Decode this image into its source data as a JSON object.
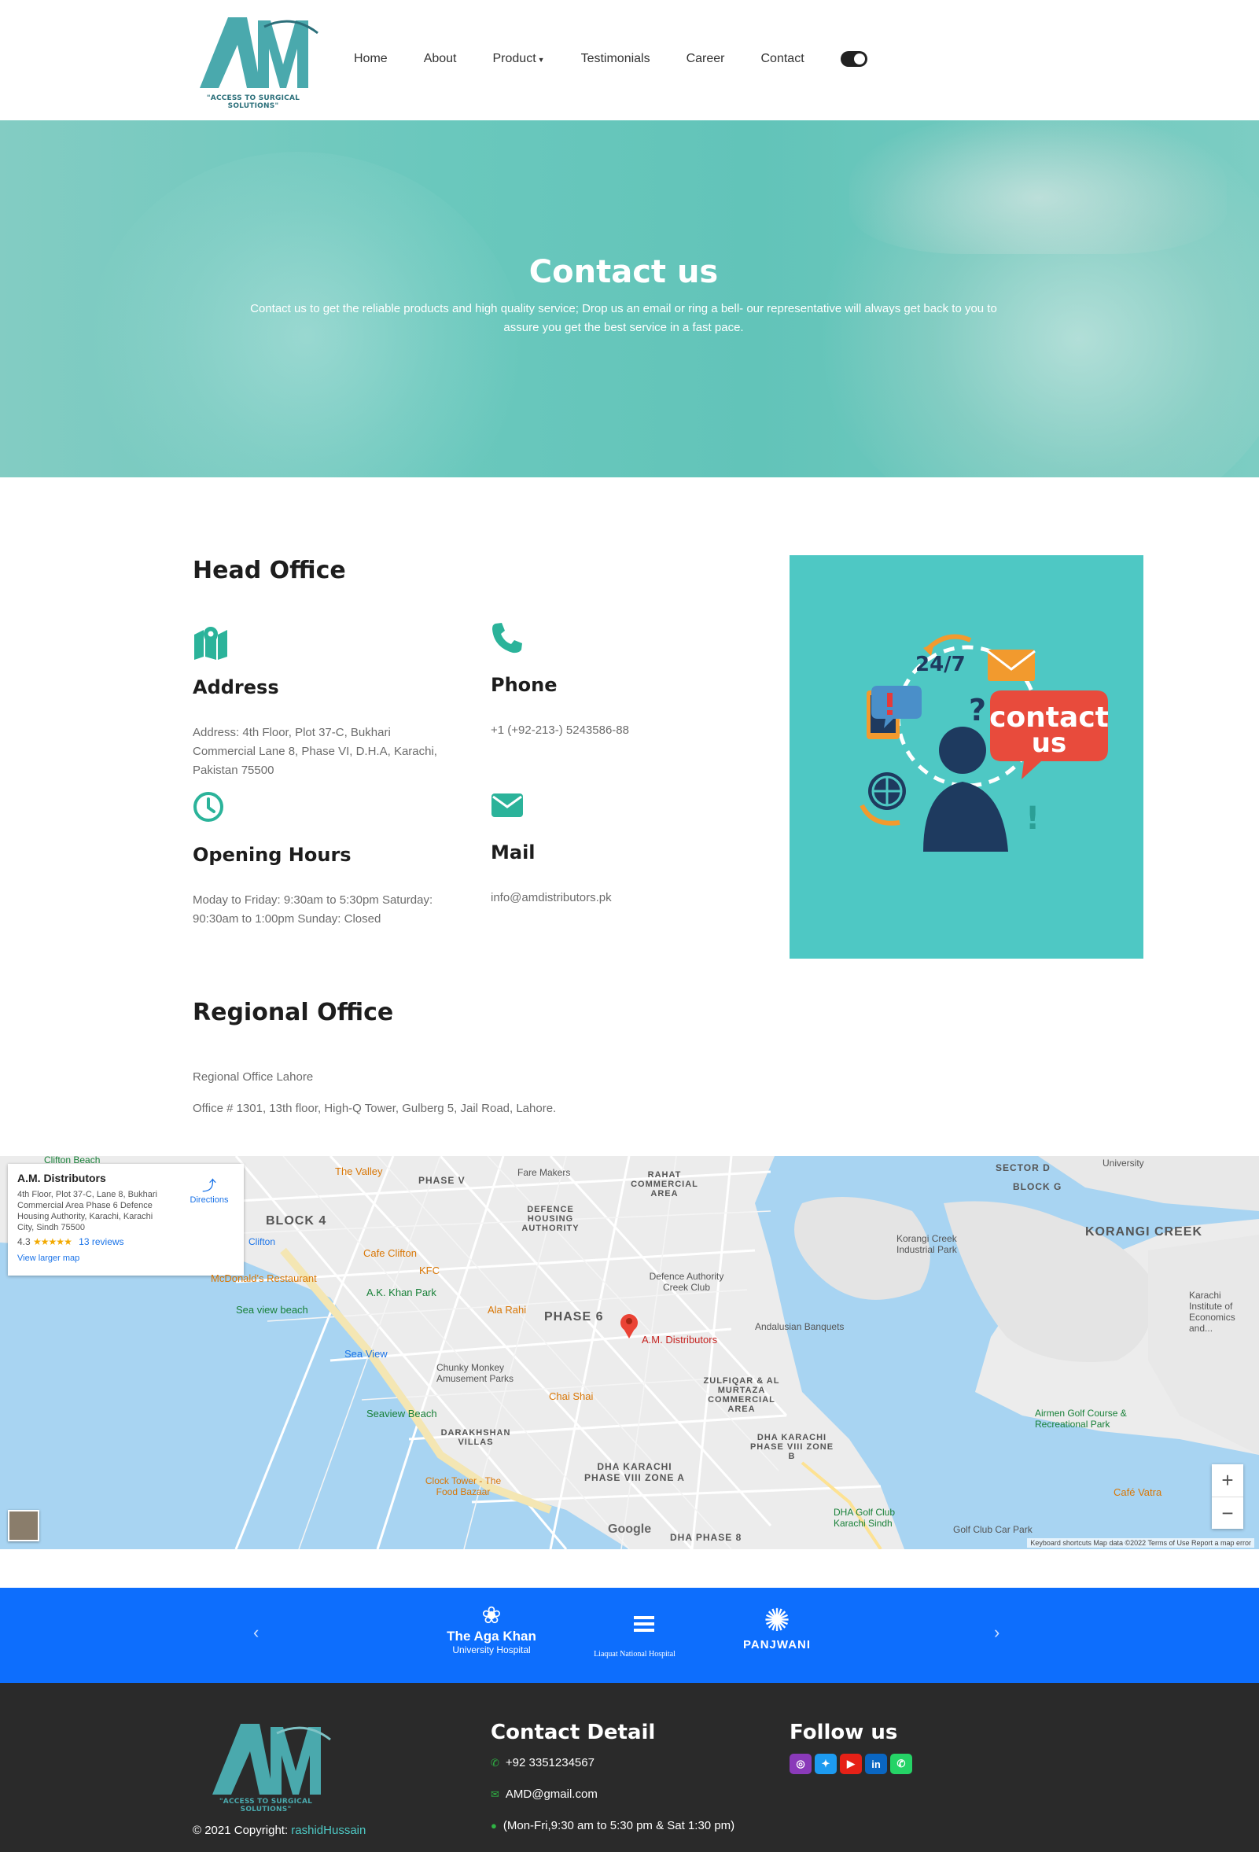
{
  "brand": {
    "tagline": "\"ACCESS TO SURGICAL SOLUTIONS\"",
    "logo_color": "#4aa9ad"
  },
  "nav": {
    "items": [
      {
        "label": "Home"
      },
      {
        "label": "About"
      },
      {
        "label": "Product"
      },
      {
        "label": "Testimonials"
      },
      {
        "label": "Career"
      },
      {
        "label": "Contact"
      }
    ],
    "theme_toggle": "on"
  },
  "hero": {
    "title": "Contact us",
    "subtitle": "Contact us to get the reliable products and high quality service; Drop us an email or ring a bell- our representative will always get back to you to assure you get the best service in a fast pace."
  },
  "head_office": {
    "title": "Head Office",
    "address": {
      "title": "Address",
      "icon": "map-marker-icon",
      "text": "Address: 4th Floor, Plot 37-C, Bukhari Commercial Lane 8, Phase VI, D.H.A, Karachi, Pakistan 75500"
    },
    "phone": {
      "title": "Phone",
      "icon": "phone-icon",
      "text": "+1 (+92-213-) 5243586-88"
    },
    "hours": {
      "title": "Opening Hours",
      "icon": "clock-icon",
      "text": "Moday to Friday: 9:30am to 5:30pm Saturday: 90:30am to 1:00pm Sunday: Closed"
    },
    "mail": {
      "title": "Mail",
      "icon": "envelope-icon",
      "text": "info@amdistributors.pk"
    },
    "image": {
      "badge": "24/7",
      "line1": "contact",
      "line2": "us",
      "bg": "#4ec8c4"
    }
  },
  "regional_office": {
    "title": "Regional Office",
    "name": "Regional Office Lahore",
    "address": "Office # 1301, 13th floor, High-Q Tower, Gulberg 5, Jail Road, Lahore."
  },
  "map": {
    "card": {
      "title": "A.M. Distributors",
      "address": "4th Floor, Plot 37-C, Lane 8, Bukhari Commercial Area Phase 6 Defence Housing Authority, Karachi, Karachi City, Sindh 75500",
      "rating": "4.3",
      "stars": "★★★★★",
      "reviews": "13 reviews",
      "larger": "View larger map",
      "directions": "Directions"
    },
    "pin_label": "A.M. Distributors",
    "labels": {
      "phase6": "PHASE 6",
      "block4": "BLOCK 4",
      "korangi": "KORANGI CREEK",
      "dha8": "DHA KARACHI PHASE VIII ZONE A",
      "defence": "DEFENCE HOUSING AUTHORITY",
      "phasev": "PHASE V",
      "rahat": "RAHAT COMMERCIAL AREA",
      "zulfiqar": "ZULFIQAR & AL MURTAZA COMMERCIAL AREA",
      "darakhshan": "DARAKHSHAN VILLAS",
      "dha8b": "DHA KARACHI PHASE VIII ZONE B",
      "sector": "SECTOR D",
      "blockg": "BLOCK G",
      "dhaphase8": "DHA PHASE 8"
    },
    "pois": [
      "The Valley",
      "Cafe Clifton",
      "KFC",
      "McDonald's Restaurant",
      "A.K. Khan Park",
      "Sea view beach",
      "Ala Rahi",
      "Sea View",
      "Chunky Monkey Amusement Parks",
      "Chai Shai",
      "Seaview Beach",
      "Clock Tower - The Food Bazaar",
      "Defence Authority Creek Club",
      "Andalusian Banquets",
      "Korangi Creek Industrial Park",
      "Airmen Golf Course & Recreational Park",
      "Café Vatra",
      "DHA Golf Club Karachi Sindh",
      "Golf Club Car Park",
      "Fare Makers",
      "Clifton Beach",
      "Clifton",
      "University",
      "Karachi Institute of Economics and..."
    ],
    "zoom_in": "+",
    "zoom_out": "−",
    "google": "Google",
    "footer": "Keyboard shortcuts   Map data ©2022   Terms of Use   Report a map error"
  },
  "partners": {
    "prev": "‹",
    "next": "›",
    "items": [
      {
        "name": "The Aga Khan",
        "sub": "University Hospital"
      },
      {
        "name": "Liaquat National Hospital",
        "sub": ""
      },
      {
        "name": "PANJWANI",
        "sub": ""
      }
    ]
  },
  "footer": {
    "contact_title": "Contact Detail",
    "phone": "+92 3351234567",
    "email": "AMD@gmail.com",
    "hours": "(Mon-Fri,9:30 am to 5:30 pm & Sat 1:30 pm)",
    "follow_title": "Follow us",
    "social": [
      "instagram-icon",
      "twitter-icon",
      "youtube-icon",
      "linkedin-icon",
      "whatsapp-icon"
    ],
    "copyright": "© 2021 Copyright:",
    "author": "rashidHussain"
  }
}
